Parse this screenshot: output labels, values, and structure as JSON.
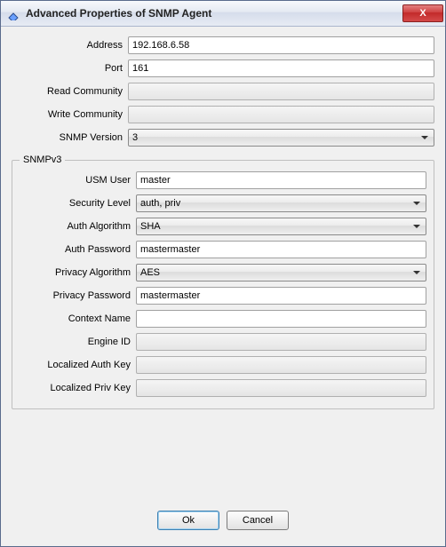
{
  "window": {
    "title": "Advanced Properties of SNMP Agent"
  },
  "labels": {
    "address": "Address",
    "port": "Port",
    "read_community": "Read Community",
    "write_community": "Write Community",
    "snmp_version": "SNMP Version",
    "snmpv3_legend": "SNMPv3",
    "usm_user": "USM User",
    "security_level": "Security Level",
    "auth_algorithm": "Auth Algorithm",
    "auth_password": "Auth Password",
    "privacy_algorithm": "Privacy Algorithm",
    "privacy_password": "Privacy Password",
    "context_name": "Context Name",
    "engine_id": "Engine ID",
    "localized_auth_key": "Localized Auth Key",
    "localized_priv_key": "Localized Priv Key"
  },
  "values": {
    "address": "192.168.6.58",
    "port": "161",
    "read_community": "",
    "write_community": "",
    "snmp_version": "3",
    "usm_user": "master",
    "security_level": "auth, priv",
    "auth_algorithm": "SHA",
    "auth_password": "mastermaster",
    "privacy_algorithm": "AES",
    "privacy_password": "mastermaster",
    "context_name": "",
    "engine_id": "",
    "localized_auth_key": "",
    "localized_priv_key": ""
  },
  "buttons": {
    "ok": "Ok",
    "cancel": "Cancel",
    "close": "X"
  }
}
